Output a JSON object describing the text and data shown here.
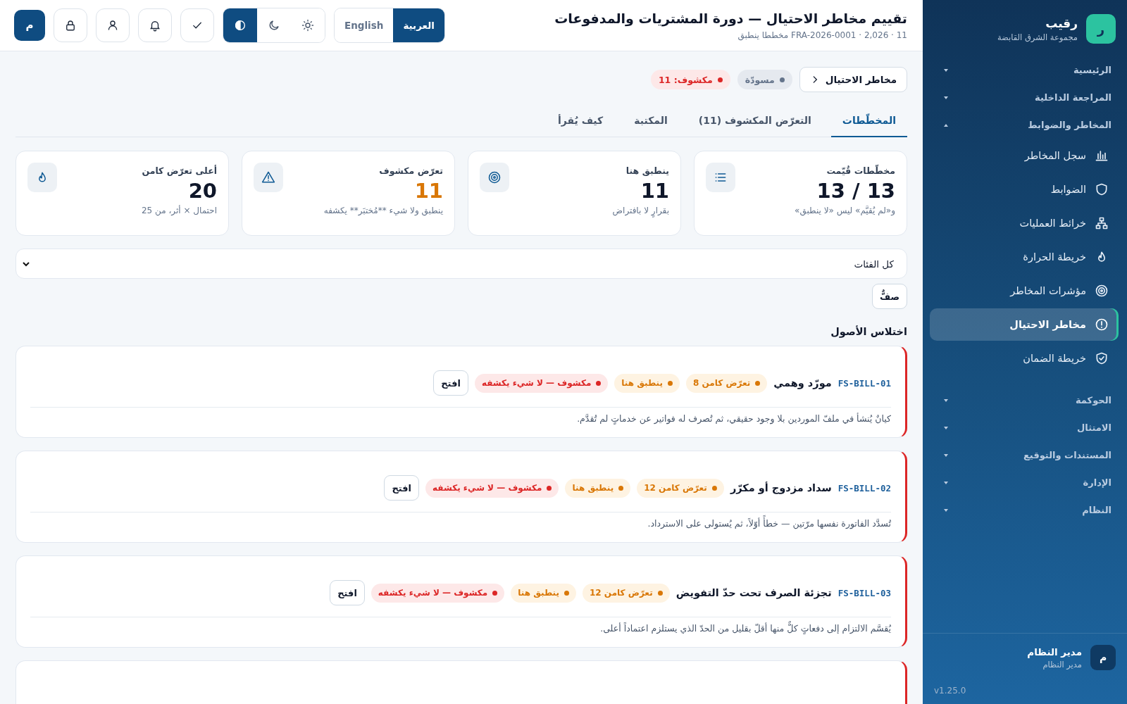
{
  "header": {
    "title": "تقييم مخاطر الاحتيال — دورة المشتريات والمدفوعات",
    "subtitle": "11 · 2,026 · FRA-2026-0001 مخططا ينطبق",
    "languages": [
      {
        "label": "العربية",
        "selected": true
      },
      {
        "label": "English",
        "selected": false
      }
    ],
    "themes": [
      {
        "kind": "light",
        "selected": false
      },
      {
        "kind": "dark",
        "selected": false
      },
      {
        "kind": "contrast",
        "selected": true
      }
    ],
    "avatar": "م"
  },
  "sidebar": {
    "brand": "رقيب",
    "brand_logo": "ر",
    "org": "مجموعة الشرق القابضة",
    "groups": [
      {
        "label": "الرئيسية",
        "expanded": false
      },
      {
        "label": "المراجعة الداخلية",
        "expanded": false
      },
      {
        "label": "المخاطر والضوابط",
        "expanded": true,
        "children": [
          {
            "label": "سجل المخاطر",
            "selected": false
          },
          {
            "label": "الضوابط",
            "selected": false
          },
          {
            "label": "خرائط العمليات",
            "selected": false
          },
          {
            "label": "خريطة الحرارة",
            "selected": false
          },
          {
            "label": "مؤشرات المخاطر",
            "selected": false
          },
          {
            "label": "مخاطر الاحتيال",
            "selected": true
          },
          {
            "label": "خريطة الضمان",
            "selected": false
          }
        ]
      },
      {
        "label": "الحوكمة",
        "expanded": false
      },
      {
        "label": "الامتثال",
        "expanded": false
      },
      {
        "label": "المستندات والتوقيع",
        "expanded": false
      },
      {
        "label": "الإدارة",
        "expanded": false
      },
      {
        "label": "النظام",
        "expanded": false
      }
    ],
    "user": {
      "avatar": "م",
      "name": "مدير النظام",
      "role": "مدير النظام"
    },
    "version": "v1.25.0"
  },
  "breadcrumb": {
    "back": "مخاطر الاحتيال",
    "pills": [
      {
        "label": "مسودّة",
        "color": "#64748b"
      },
      {
        "label": "مكشوف: 11",
        "color": "#dc2626"
      }
    ]
  },
  "tabs": [
    {
      "label": "المخطّطات",
      "selected": true
    },
    {
      "label": "التعرّض المكشوف (11)",
      "selected": false
    },
    {
      "label": "المكتبة",
      "selected": false
    },
    {
      "label": "كيف يُقرأ",
      "selected": false
    }
  ],
  "stats": [
    {
      "label": "مخطّطات قُيّمت",
      "value": "13 / 13",
      "note": "و«لم يُقيَّم» ليس «لا ينطبق»",
      "kind": "normal"
    },
    {
      "label": "ينطبق هنا",
      "value": "11",
      "note": "بقرارٍ لا بافتراض",
      "kind": "normal"
    },
    {
      "label": "تعرّض مكشوف",
      "value": "11",
      "note": "ينطبق ولا شيء **مُختبَر** يكشفه",
      "kind": "warning"
    },
    {
      "label": "أعلى تعرّض كامن",
      "value": "20",
      "note": "احتمال × أثر، من 25",
      "kind": "normal"
    }
  ],
  "filter": {
    "value": "كل الفئات"
  },
  "row_button": "صفٌّ",
  "section": "اختلاس الأصول",
  "schemes": [
    {
      "id": "FS-BILL-01",
      "title": "مورّد وهمي",
      "tags": [
        {
          "label": "تعرّض كامن 8",
          "kind": "latent"
        },
        {
          "label": "ينطبق هنا",
          "kind": "applies"
        },
        {
          "label": "مكشوف — لا شيء يكشفه",
          "kind": "exposed"
        }
      ],
      "action": "افتح",
      "description": "كيانٌ يُنشأ في ملفّ الموردين بلا وجود حقيقي، ثم تُصرف له فواتير عن خدماتٍ لم تُقدَّم."
    },
    {
      "id": "FS-BILL-02",
      "title": "سداد مزدوج أو مكرّر",
      "tags": [
        {
          "label": "تعرّض كامن 12",
          "kind": "latent"
        },
        {
          "label": "ينطبق هنا",
          "kind": "applies"
        },
        {
          "label": "مكشوف — لا شيء يكشفه",
          "kind": "exposed"
        }
      ],
      "action": "افتح",
      "description": "تُسدَّد الفاتورة نفسها مرّتين — خطأً أوّلاً، ثم يُستولى على الاسترداد."
    },
    {
      "id": "FS-BILL-03",
      "title": "تجزئة الصرف تحت حدّ التفويض",
      "tags": [
        {
          "label": "تعرّض كامن 12",
          "kind": "latent"
        },
        {
          "label": "ينطبق هنا",
          "kind": "applies"
        },
        {
          "label": "مكشوف — لا شيء يكشفه",
          "kind": "exposed"
        }
      ],
      "action": "افتح",
      "description": "يُقسَّم الالتزام إلى دفعاتٍ كلٌّ منها أقلّ بقليل من الحدّ الذي يستلزم اعتماداً أعلى."
    }
  ]
}
